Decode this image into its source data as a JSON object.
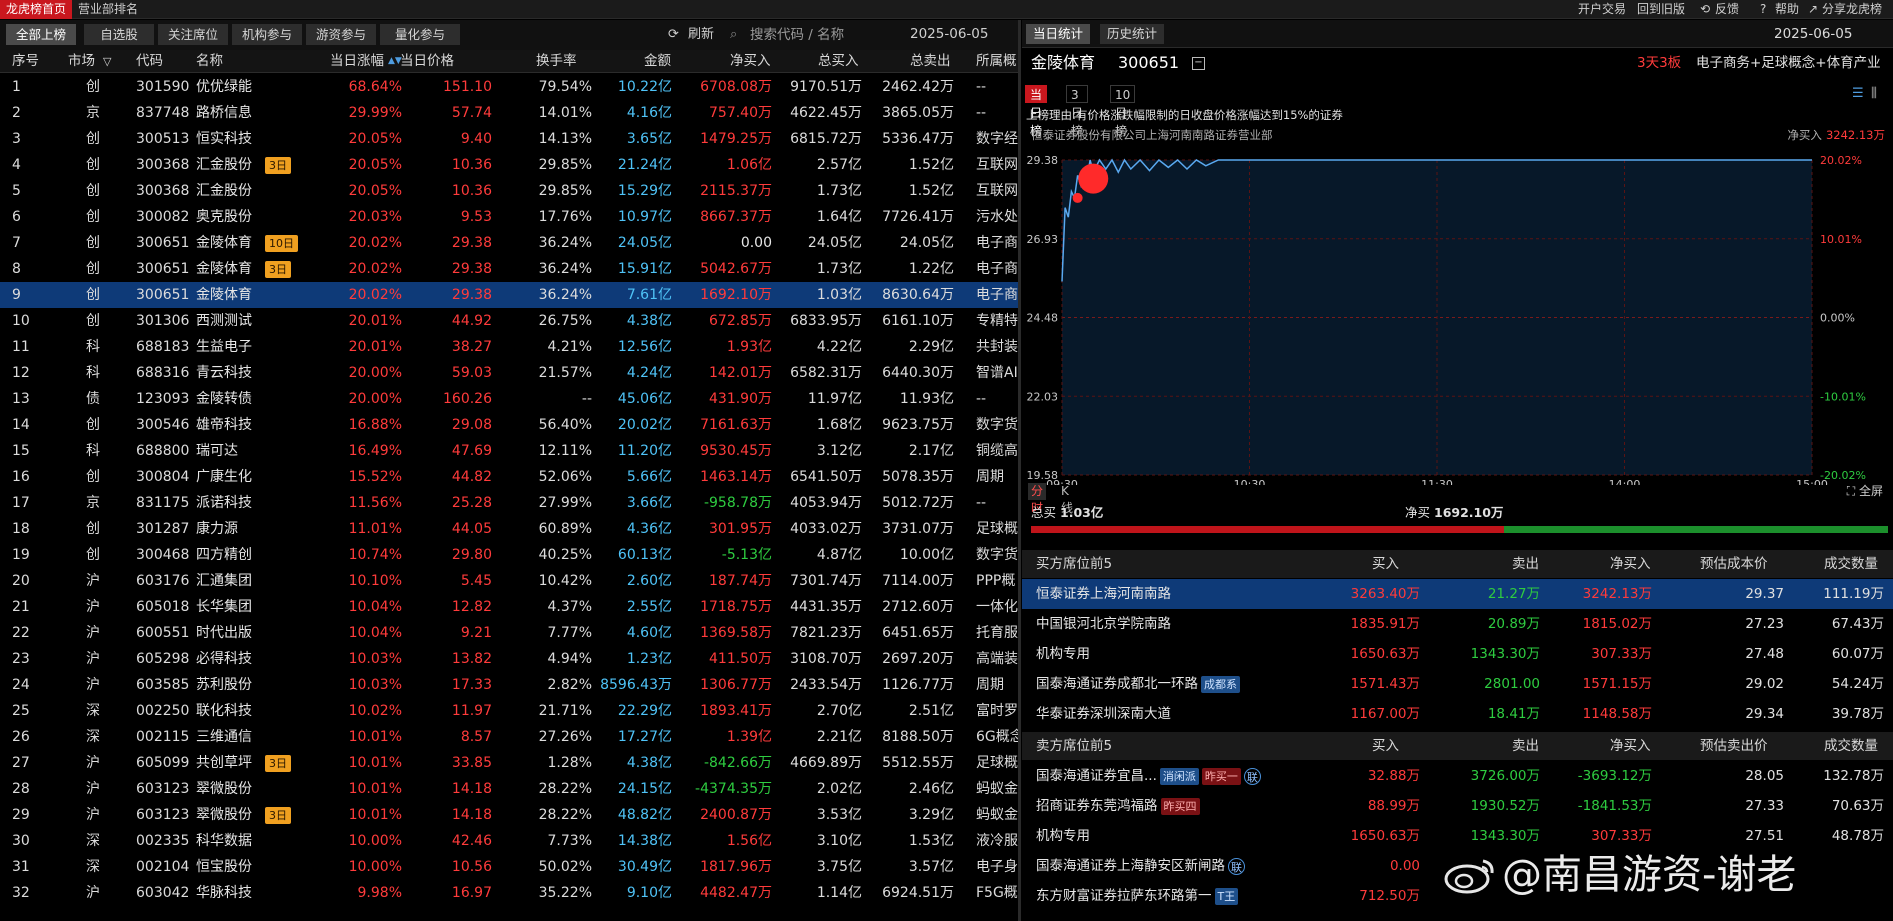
{
  "top": {
    "tabs": [
      "龙虎榜首页",
      "营业部排名"
    ],
    "links": [
      "开户交易",
      "回到旧版",
      "反馈",
      "帮助",
      "分享龙虎榜"
    ]
  },
  "left": {
    "subtabs": [
      "全部上榜",
      "自选股",
      "关注席位",
      "机构参与",
      "游资参与",
      "量化参与"
    ],
    "refresh": "刷新",
    "search_placeholder": "搜索代码 / 名称",
    "date": "2025-06-05",
    "columns": [
      "序号",
      "市场",
      "代码",
      "名称",
      "当日涨幅",
      "当日价格",
      "换手率",
      "金额",
      "净买入",
      "总买入",
      "总卖出",
      "所属概"
    ],
    "rows": [
      {
        "seq": "1",
        "mkt": "创",
        "code": "301590",
        "name": "优优绿能",
        "tag": "",
        "chg": "68.64%",
        "price": "151.10",
        "turn": "79.54%",
        "amt": "10.22亿",
        "net": "6708.08万",
        "dir": "up",
        "buy": "9170.51万",
        "sell": "2462.42万",
        "sect": "--"
      },
      {
        "seq": "2",
        "mkt": "京",
        "code": "837748",
        "name": "路桥信息",
        "tag": "",
        "chg": "29.99%",
        "price": "57.74",
        "turn": "14.01%",
        "amt": "4.16亿",
        "net": "757.40万",
        "dir": "up",
        "buy": "4622.45万",
        "sell": "3865.05万",
        "sect": "--"
      },
      {
        "seq": "3",
        "mkt": "创",
        "code": "300513",
        "name": "恒实科技",
        "tag": "",
        "chg": "20.05%",
        "price": "9.40",
        "turn": "14.13%",
        "amt": "3.65亿",
        "net": "1479.25万",
        "dir": "up",
        "buy": "6815.72万",
        "sell": "5336.47万",
        "sect": "数字经"
      },
      {
        "seq": "4",
        "mkt": "创",
        "code": "300368",
        "name": "汇金股份",
        "tag": "3日",
        "chg": "20.05%",
        "price": "10.36",
        "turn": "29.85%",
        "amt": "21.24亿",
        "net": "1.06亿",
        "dir": "up",
        "buy": "2.57亿",
        "sell": "1.52亿",
        "sect": "互联网"
      },
      {
        "seq": "5",
        "mkt": "创",
        "code": "300368",
        "name": "汇金股份",
        "tag": "",
        "chg": "20.05%",
        "price": "10.36",
        "turn": "29.85%",
        "amt": "15.29亿",
        "net": "2115.37万",
        "dir": "up",
        "buy": "1.73亿",
        "sell": "1.52亿",
        "sect": "互联网"
      },
      {
        "seq": "6",
        "mkt": "创",
        "code": "300082",
        "name": "奥克股份",
        "tag": "",
        "chg": "20.03%",
        "price": "9.53",
        "turn": "17.76%",
        "amt": "10.97亿",
        "net": "8667.37万",
        "dir": "up",
        "buy": "1.64亿",
        "sell": "7726.41万",
        "sect": "污水处"
      },
      {
        "seq": "7",
        "mkt": "创",
        "code": "300651",
        "name": "金陵体育",
        "tag": "10日",
        "chg": "20.02%",
        "price": "29.38",
        "turn": "36.24%",
        "amt": "24.05亿",
        "net": "0.00",
        "dir": "flat",
        "buy": "24.05亿",
        "sell": "24.05亿",
        "sect": "电子商"
      },
      {
        "seq": "8",
        "mkt": "创",
        "code": "300651",
        "name": "金陵体育",
        "tag": "3日",
        "chg": "20.02%",
        "price": "29.38",
        "turn": "36.24%",
        "amt": "15.91亿",
        "net": "5042.67万",
        "dir": "up",
        "buy": "1.73亿",
        "sell": "1.22亿",
        "sect": "电子商"
      },
      {
        "seq": "9",
        "mkt": "创",
        "code": "300651",
        "name": "金陵体育",
        "tag": "",
        "chg": "20.02%",
        "price": "29.38",
        "turn": "36.24%",
        "amt": "7.61亿",
        "net": "1692.10万",
        "dir": "up",
        "buy": "1.03亿",
        "sell": "8630.64万",
        "sect": "电子商",
        "sel": true
      },
      {
        "seq": "10",
        "mkt": "创",
        "code": "301306",
        "name": "西测测试",
        "tag": "",
        "chg": "20.01%",
        "price": "44.92",
        "turn": "26.75%",
        "amt": "4.38亿",
        "net": "672.85万",
        "dir": "up",
        "buy": "6833.95万",
        "sell": "6161.10万",
        "sect": "专精特"
      },
      {
        "seq": "11",
        "mkt": "科",
        "code": "688183",
        "name": "生益电子",
        "tag": "",
        "chg": "20.01%",
        "price": "38.27",
        "turn": "4.21%",
        "amt": "12.56亿",
        "net": "1.93亿",
        "dir": "up",
        "buy": "4.22亿",
        "sell": "2.29亿",
        "sect": "共封装"
      },
      {
        "seq": "12",
        "mkt": "科",
        "code": "688316",
        "name": "青云科技",
        "tag": "",
        "chg": "20.00%",
        "price": "59.03",
        "turn": "21.57%",
        "amt": "4.24亿",
        "net": "142.01万",
        "dir": "up",
        "buy": "6582.31万",
        "sell": "6440.30万",
        "sect": "智谱AI"
      },
      {
        "seq": "13",
        "mkt": "债",
        "code": "123093",
        "name": "金陵转债",
        "tag": "",
        "chg": "20.00%",
        "price": "160.26",
        "turn": "--",
        "amt": "45.06亿",
        "net": "431.90万",
        "dir": "up",
        "buy": "11.97亿",
        "sell": "11.93亿",
        "sect": "--"
      },
      {
        "seq": "14",
        "mkt": "创",
        "code": "300546",
        "name": "雄帝科技",
        "tag": "",
        "chg": "16.88%",
        "price": "29.08",
        "turn": "56.40%",
        "amt": "20.02亿",
        "net": "7161.63万",
        "dir": "up",
        "buy": "1.68亿",
        "sell": "9623.75万",
        "sect": "数字货"
      },
      {
        "seq": "15",
        "mkt": "科",
        "code": "688800",
        "name": "瑞可达",
        "tag": "",
        "chg": "16.49%",
        "price": "47.69",
        "turn": "12.11%",
        "amt": "11.20亿",
        "net": "9530.45万",
        "dir": "up",
        "buy": "3.12亿",
        "sell": "2.17亿",
        "sect": "铜缆高"
      },
      {
        "seq": "16",
        "mkt": "创",
        "code": "300804",
        "name": "广康生化",
        "tag": "",
        "chg": "15.52%",
        "price": "44.82",
        "turn": "52.06%",
        "amt": "5.66亿",
        "net": "1463.14万",
        "dir": "up",
        "buy": "6541.50万",
        "sell": "5078.35万",
        "sect": "周期"
      },
      {
        "seq": "17",
        "mkt": "京",
        "code": "831175",
        "name": "派诺科技",
        "tag": "",
        "chg": "11.56%",
        "price": "25.28",
        "turn": "27.99%",
        "amt": "3.66亿",
        "net": "-958.78万",
        "dir": "down",
        "buy": "4053.94万",
        "sell": "5012.72万",
        "sect": "--"
      },
      {
        "seq": "18",
        "mkt": "创",
        "code": "301287",
        "name": "康力源",
        "tag": "",
        "chg": "11.01%",
        "price": "44.05",
        "turn": "60.89%",
        "amt": "4.36亿",
        "net": "301.95万",
        "dir": "up",
        "buy": "4033.02万",
        "sell": "3731.07万",
        "sect": "足球概"
      },
      {
        "seq": "19",
        "mkt": "创",
        "code": "300468",
        "name": "四方精创",
        "tag": "",
        "chg": "10.74%",
        "price": "29.80",
        "turn": "40.25%",
        "amt": "60.13亿",
        "net": "-5.13亿",
        "dir": "down",
        "buy": "4.87亿",
        "sell": "10.00亿",
        "sect": "数字货"
      },
      {
        "seq": "20",
        "mkt": "沪",
        "code": "603176",
        "name": "汇通集团",
        "tag": "",
        "chg": "10.10%",
        "price": "5.45",
        "turn": "10.42%",
        "amt": "2.60亿",
        "net": "187.74万",
        "dir": "up",
        "buy": "7301.74万",
        "sell": "7114.00万",
        "sect": "PPP概"
      },
      {
        "seq": "21",
        "mkt": "沪",
        "code": "605018",
        "name": "长华集团",
        "tag": "",
        "chg": "10.04%",
        "price": "12.82",
        "turn": "4.37%",
        "amt": "2.55亿",
        "net": "1718.75万",
        "dir": "up",
        "buy": "4431.35万",
        "sell": "2712.60万",
        "sect": "一体化"
      },
      {
        "seq": "22",
        "mkt": "沪",
        "code": "600551",
        "name": "时代出版",
        "tag": "",
        "chg": "10.04%",
        "price": "9.21",
        "turn": "7.77%",
        "amt": "4.60亿",
        "net": "1369.58万",
        "dir": "up",
        "buy": "7821.23万",
        "sell": "6451.65万",
        "sect": "托育服"
      },
      {
        "seq": "23",
        "mkt": "沪",
        "code": "605298",
        "name": "必得科技",
        "tag": "",
        "chg": "10.03%",
        "price": "13.82",
        "turn": "4.94%",
        "amt": "1.23亿",
        "net": "411.50万",
        "dir": "up",
        "buy": "3108.70万",
        "sell": "2697.20万",
        "sect": "高端装"
      },
      {
        "seq": "24",
        "mkt": "沪",
        "code": "603585",
        "name": "苏利股份",
        "tag": "",
        "chg": "10.03%",
        "price": "17.33",
        "turn": "2.82%",
        "amt": "8596.43万",
        "net": "1306.77万",
        "dir": "up",
        "buy": "2433.54万",
        "sell": "1126.77万",
        "sect": "周期"
      },
      {
        "seq": "25",
        "mkt": "深",
        "code": "002250",
        "name": "联化科技",
        "tag": "",
        "chg": "10.02%",
        "price": "11.97",
        "turn": "21.71%",
        "amt": "22.29亿",
        "net": "1893.41万",
        "dir": "up",
        "buy": "2.70亿",
        "sell": "2.51亿",
        "sect": "富时罗"
      },
      {
        "seq": "26",
        "mkt": "深",
        "code": "002115",
        "name": "三维通信",
        "tag": "",
        "chg": "10.01%",
        "price": "8.57",
        "turn": "27.26%",
        "amt": "17.27亿",
        "net": "1.39亿",
        "dir": "up",
        "buy": "2.21亿",
        "sell": "8188.50万",
        "sect": "6G概念"
      },
      {
        "seq": "27",
        "mkt": "沪",
        "code": "605099",
        "name": "共创草坪",
        "tag": "3日",
        "chg": "10.01%",
        "price": "33.85",
        "turn": "1.28%",
        "amt": "4.38亿",
        "net": "-842.66万",
        "dir": "down",
        "buy": "4669.89万",
        "sell": "5512.55万",
        "sect": "足球概"
      },
      {
        "seq": "28",
        "mkt": "沪",
        "code": "603123",
        "name": "翠微股份",
        "tag": "",
        "chg": "10.01%",
        "price": "14.18",
        "turn": "28.22%",
        "amt": "24.15亿",
        "net": "-4374.35万",
        "dir": "down",
        "buy": "2.02亿",
        "sell": "2.46亿",
        "sect": "蚂蚁金"
      },
      {
        "seq": "29",
        "mkt": "沪",
        "code": "603123",
        "name": "翠微股份",
        "tag": "3日",
        "chg": "10.01%",
        "price": "14.18",
        "turn": "28.22%",
        "amt": "48.82亿",
        "net": "2400.87万",
        "dir": "up",
        "buy": "3.53亿",
        "sell": "3.29亿",
        "sect": "蚂蚁金"
      },
      {
        "seq": "30",
        "mkt": "深",
        "code": "002335",
        "name": "科华数据",
        "tag": "",
        "chg": "10.00%",
        "price": "42.46",
        "turn": "7.73%",
        "amt": "14.38亿",
        "net": "1.56亿",
        "dir": "up",
        "buy": "3.10亿",
        "sell": "1.53亿",
        "sect": "液冷服"
      },
      {
        "seq": "31",
        "mkt": "深",
        "code": "002104",
        "name": "恒宝股份",
        "tag": "",
        "chg": "10.00%",
        "price": "10.56",
        "turn": "50.02%",
        "amt": "30.49亿",
        "net": "1817.96万",
        "dir": "up",
        "buy": "3.75亿",
        "sell": "3.57亿",
        "sect": "电子身"
      },
      {
        "seq": "32",
        "mkt": "沪",
        "code": "603042",
        "name": "华脉科技",
        "tag": "",
        "chg": "9.98%",
        "price": "16.97",
        "turn": "35.22%",
        "amt": "9.10亿",
        "net": "4482.47万",
        "dir": "up",
        "buy": "1.14亿",
        "sell": "6924.51万",
        "sect": "F5G概"
      }
    ]
  },
  "right": {
    "tabs": [
      "当日统计",
      "历史统计"
    ],
    "date": "2025-06-05",
    "stock_name": "金陵体育",
    "stock_code": "300651",
    "board": "3天3板",
    "concepts": "电子商务+足球概念+体育产业",
    "chart_tabs": [
      "当日榜",
      "3日榜",
      "10日榜"
    ],
    "reason": "上榜理由:有价格涨跌幅限制的日收盘价格涨幅达到15%的证券",
    "broker": "恒泰证券股份有限公司上海河南南路证券营业部",
    "net_label": "净买入",
    "net_value": "3242.13万",
    "mode_tabs": [
      "分时",
      "K线"
    ],
    "fullscreen": "全屏",
    "total_buy_label": "总买",
    "total_buy": "1.03亿",
    "net_buy_label": "净买",
    "net_buy": "1692.10万",
    "buy_head": [
      "买方席位前5",
      "买入",
      "卖出",
      "净买入",
      "预估成本价",
      "成交数量"
    ],
    "buy_rows": [
      {
        "name": "恒泰证券上海河南南路",
        "tags": [],
        "buy": "3263.40万",
        "sell": "21.27万",
        "net": "3242.13万",
        "dir": "up",
        "cost": "29.37",
        "vol": "111.19万",
        "sel": true
      },
      {
        "name": "中国银河北京学院南路",
        "tags": [],
        "buy": "1835.91万",
        "sell": "20.89万",
        "net": "1815.02万",
        "dir": "up",
        "cost": "27.23",
        "vol": "67.43万"
      },
      {
        "name": "机构专用",
        "tags": [],
        "buy": "1650.63万",
        "sell": "1343.30万",
        "net": "307.33万",
        "dir": "up",
        "cost": "27.48",
        "vol": "60.07万"
      },
      {
        "name": "国泰海通证券成都北一环路",
        "tags": [
          {
            "t": "成都系",
            "c": "blue"
          }
        ],
        "buy": "1571.43万",
        "sell": "2801.00",
        "net": "1571.15万",
        "dir": "up",
        "cost": "29.02",
        "vol": "54.24万"
      },
      {
        "name": "华泰证券深圳深南大道",
        "tags": [],
        "buy": "1167.00万",
        "sell": "18.41万",
        "net": "1148.58万",
        "dir": "up",
        "cost": "29.34",
        "vol": "39.78万"
      }
    ],
    "sell_head": [
      "卖方席位前5",
      "买入",
      "卖出",
      "净买入",
      "预估卖出价",
      "成交数量"
    ],
    "sell_rows": [
      {
        "name": "国泰海通证券宜昌...",
        "tags": [
          {
            "t": "消闲派",
            "c": "blue"
          },
          {
            "t": "昨买一",
            "c": "red"
          },
          {
            "t": "联",
            "c": "circle"
          }
        ],
        "buy": "32.88万",
        "sell": "3726.00万",
        "net": "-3693.12万",
        "dir": "down",
        "cost": "28.05",
        "vol": "132.78万"
      },
      {
        "name": "招商证券东莞鸿福路",
        "tags": [
          {
            "t": "昨买四",
            "c": "red"
          }
        ],
        "buy": "88.99万",
        "sell": "1930.52万",
        "net": "-1841.53万",
        "dir": "down",
        "cost": "27.33",
        "vol": "70.63万"
      },
      {
        "name": "机构专用",
        "tags": [],
        "buy": "1650.63万",
        "sell": "1343.30万",
        "net": "307.33万",
        "dir": "up",
        "cost": "27.51",
        "vol": "48.78万"
      },
      {
        "name": "国泰海通证券上海静安区新闸路",
        "tags": [
          {
            "t": "联",
            "c": "circle"
          }
        ],
        "buy": "0.00",
        "sell": "",
        "net": "",
        "dir": "down",
        "cost": "",
        "vol": ""
      },
      {
        "name": "东方财富证券拉萨东环路第一",
        "tags": [
          {
            "t": "T王",
            "c": "blue"
          }
        ],
        "buy": "712.50万",
        "sell": "",
        "net": "",
        "dir": "down",
        "cost": "",
        "vol": ""
      }
    ],
    "watermark": "@南昌游资-谢老"
  },
  "chart_data": {
    "type": "line",
    "x_ticks": [
      "09:30",
      "10:30",
      "11:30",
      "14:00",
      "15:00"
    ],
    "y_left": [
      "29.38",
      "26.93",
      "24.48",
      "22.03",
      "19.58"
    ],
    "y_right": [
      "20.02%",
      "10.01%",
      "0.00%",
      "-10.01%",
      "-20.02%"
    ],
    "ylim": [
      19.58,
      29.38
    ],
    "x_minutes": [
      0,
      1,
      2,
      3,
      4,
      5,
      6,
      7,
      8,
      9,
      10,
      12,
      14,
      16,
      18,
      20,
      22,
      25,
      28,
      31,
      34,
      37,
      40,
      43,
      46,
      50,
      60,
      90,
      150,
      240
    ],
    "price": [
      25.6,
      27.9,
      27.6,
      28.4,
      28.2,
      28.9,
      28.6,
      29.1,
      28.8,
      29.38,
      29.0,
      29.38,
      29.1,
      29.38,
      29.0,
      29.38,
      29.1,
      29.38,
      29.05,
      29.38,
      29.15,
      29.38,
      29.1,
      29.38,
      29.2,
      29.38,
      29.38,
      29.38,
      29.38,
      29.38
    ],
    "markers": [
      {
        "minute": 5,
        "price": 28.2,
        "size": "small"
      },
      {
        "minute": 10,
        "price": 28.8,
        "size": "large"
      }
    ]
  }
}
